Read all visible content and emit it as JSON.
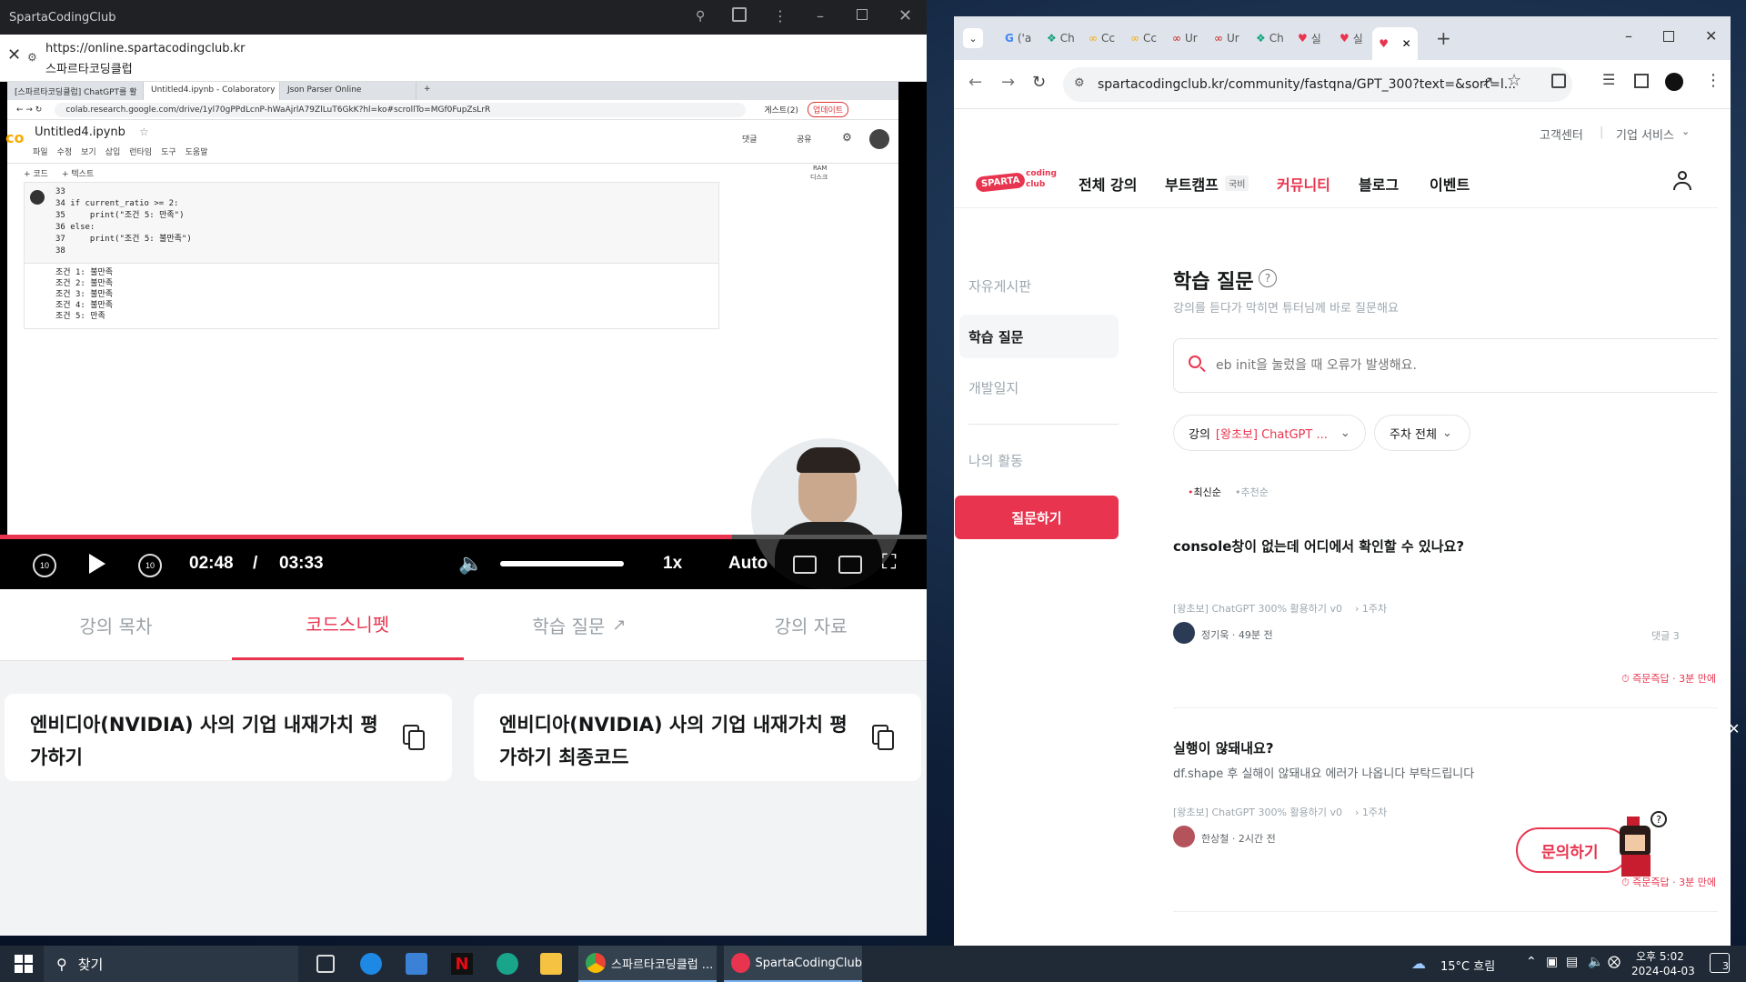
{
  "left_window": {
    "title": "SpartaCodingClub",
    "url": "https://online.spartacodingclub.kr",
    "site_name": "스파르타코딩클럽",
    "colab": {
      "tabs": [
        "[스파르타코딩클럽] ChatGPT를 활",
        "Untitled4.ipynb - Colaboratory",
        "Json Parser Online"
      ],
      "address": "colab.research.google.com/drive/1yl70gPPdLcnP-hWaAjrlA79ZlLuT6GkK?hl=ko#scrollTo=MGf0FupZsLrR",
      "guest": "게스트(2)",
      "upgrade": "업데이트",
      "notebook": "Untitled4.ipynb",
      "menu": [
        "파일",
        "수정",
        "보기",
        "삽입",
        "런타임",
        "도구",
        "도움말"
      ],
      "toolbar": [
        "+ 코드",
        "+ 텍스트"
      ],
      "comment": "댓글",
      "share": "공유",
      "ram": "RAM",
      "disk": "디스크",
      "code_lines": [
        "33",
        "34 if current_ratio >= 2:",
        "35     print(\"조건 5: 만족\")",
        "36 else:",
        "37     print(\"조건 5: 불만족\")",
        "38"
      ],
      "output_lines": [
        "조건 1: 불만족",
        "조건 2: 불만족",
        "조건 3: 불만족",
        "조건 4: 불만족",
        "조건 5: 만족"
      ]
    },
    "player": {
      "current": "02:48",
      "separator": "/",
      "total": "03:33",
      "speed": "1x",
      "quality": "Auto",
      "progress": 0.79,
      "volume": 1.0
    },
    "tabs": [
      "강의 목차",
      "코드스니펫",
      "학습 질문",
      "강의 자료"
    ],
    "active_tab": 1,
    "snippets": [
      "엔비디아(NVIDIA) 사의 기업 내재가치 평가하기",
      "엔비디아(NVIDIA) 사의 기업 내재가치 평가하기 최종코드"
    ]
  },
  "right_window": {
    "tab_labels": [
      "('a",
      "Ch",
      "Cc",
      "Cc",
      "Ur",
      "Ur",
      "Ch",
      "실",
      "실"
    ],
    "address": "spartacodingclub.kr/community/fastqna/GPT_300?text=&sort=l...",
    "top_links": [
      "고객센터",
      "기업 서비스"
    ],
    "logo": [
      "SPARTA",
      "coding",
      "club"
    ],
    "nav": [
      "전체 강의",
      "부트캠프",
      "국비",
      "커뮤니티",
      "블로그",
      "이벤트"
    ],
    "sidebar": [
      "자유게시판",
      "학습 질문",
      "개발일지",
      "나의 활동"
    ],
    "ask_button": "질문하기",
    "heading": "학습 질문",
    "subheading": "강의를 듣다가 막히면 튜터님께 바로 질문해요",
    "search_placeholder": "eb init을 눌렀을 때 오류가 발생해요.",
    "filter_course_label": "강의",
    "filter_course_value": "[왕초보] ChatGPT ...",
    "filter_week": "주차 전체",
    "sort": [
      "최신순",
      "추천순"
    ],
    "questions": [
      {
        "title": "console창이 없는데 어디에서 확인할 수 있나요?",
        "body": "",
        "meta": "[왕초보] ChatGPT 300% 활용하기 v0",
        "week": "1주차",
        "user": "정기욱 · 49분 전",
        "comments": "댓글 3",
        "answer": "즉문즉답 · 3분 만에"
      },
      {
        "title": "실행이 않돼내요?",
        "body": "df.shape 후 실해이 않돼내요 에러가 나옵니다 부탁드립니다",
        "meta": "[왕초보] ChatGPT 300% 활용하기 v0",
        "week": "1주차",
        "user": "한상철 · 2시간 전",
        "comments": "",
        "answer": "즉문즉답 · 3분 만에"
      }
    ],
    "contact_button": "문의하기"
  },
  "taskbar": {
    "search": "찾기",
    "apps": [
      "스파르타코딩클럽 ...",
      "SpartaCodingClub"
    ],
    "weather": "15°C  흐림",
    "time": "오후 5:02",
    "date": "2024-04-03",
    "notifications": "3"
  },
  "colors": {
    "accent": "#e8344e",
    "dark": "#202124"
  }
}
